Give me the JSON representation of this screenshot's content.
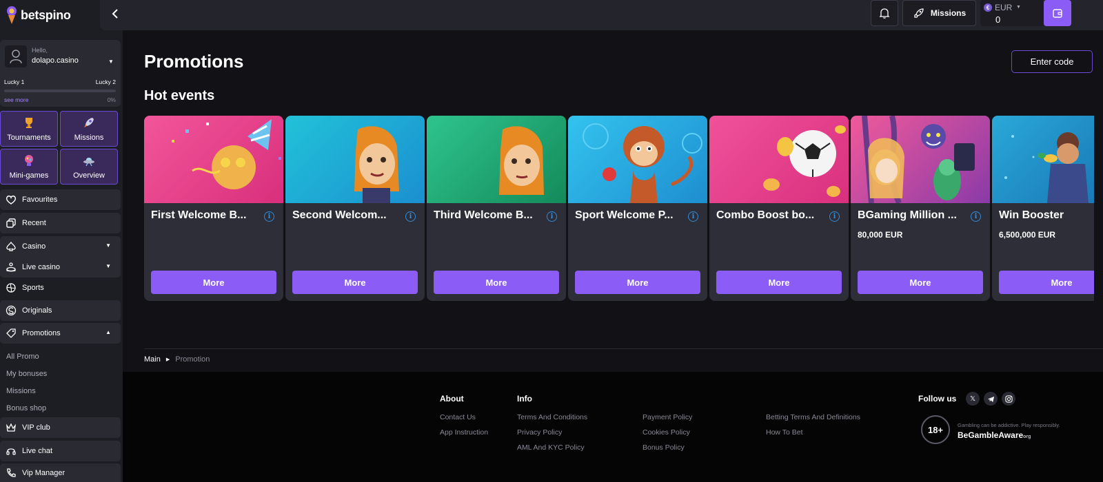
{
  "brand": {
    "name": "betspino"
  },
  "user": {
    "greeting": "Hello,",
    "username": "dolapo.casino",
    "level_current": "Lucky 1",
    "level_next": "Lucky 2",
    "progress_percent": 0,
    "progress_label": "0%",
    "see_more": "see more"
  },
  "quick_links": [
    {
      "label": "Tournaments",
      "icon": "trophy-icon"
    },
    {
      "label": "Missions",
      "icon": "rocket-icon"
    },
    {
      "label": "Mini-games",
      "icon": "gumball-icon"
    },
    {
      "label": "Overview",
      "icon": "ufo-icon"
    }
  ],
  "nav": {
    "favourites": "Favourites",
    "recent": "Recent",
    "casino": "Casino",
    "live_casino": "Live casino",
    "sports": "Sports",
    "originals": "Originals",
    "promotions": "Promotions",
    "promo_sub": [
      "All Promo",
      "My bonuses",
      "Missions",
      "Bonus shop"
    ],
    "vip_club": "VIP club",
    "live_chat": "Live chat",
    "vip_manager": "Vip Manager"
  },
  "topbar": {
    "missions_label": "Missions",
    "currency": "EUR",
    "balance": "0"
  },
  "main": {
    "title": "Promotions",
    "enter_code": "Enter code",
    "section_title": "Hot events",
    "cards": [
      {
        "title": "First Welcome B...",
        "amount": "",
        "button": "More",
        "bg": "#e83f8f"
      },
      {
        "title": "Second Welcom...",
        "amount": "",
        "button": "More",
        "bg": "#1fb3d6"
      },
      {
        "title": "Third Welcome B...",
        "amount": "",
        "button": "More",
        "bg": "#21b07a"
      },
      {
        "title": "Sport Welcome P...",
        "amount": "",
        "button": "More",
        "bg": "#2ab4e6"
      },
      {
        "title": "Combo Boost bo...",
        "amount": "",
        "button": "More",
        "bg": "#e73b8c"
      },
      {
        "title": "BGaming Million ...",
        "amount": "80,000 EUR",
        "button": "More",
        "bg": "#d94a8f"
      },
      {
        "title": "Win Booster",
        "amount": "6,500,000 EUR",
        "button": "More",
        "bg": "#1e8ec9"
      }
    ],
    "breadcrumb": {
      "main": "Main",
      "current": "Promotion"
    }
  },
  "footer": {
    "about_heading": "About",
    "about_links": [
      "Contact Us",
      "App Instruction"
    ],
    "info_heading": "Info",
    "info_col1": [
      "Terms And Conditions",
      "Privacy Policy",
      "AML And KYC Policy"
    ],
    "info_col2": [
      "Payment Policy",
      "Cookies Policy",
      "Bonus Policy"
    ],
    "info_col3": [
      "Betting Terms And Definitions",
      "How To Bet"
    ],
    "follow_us": "Follow us",
    "socials": [
      "X",
      "telegram",
      "instagram"
    ],
    "age_badge": "18+",
    "gamble_note": "Gambling can be addictive. Play responsibly.",
    "gamble_brand": "BeGambleAware",
    "gamble_brand_suffix": "org"
  },
  "colors": {
    "accent": "#8b5cf6",
    "sidebar_bg": "#1d1d24",
    "card_bg": "#2e2e38",
    "page_bg": "#111116",
    "info": "#2f8ddc"
  }
}
